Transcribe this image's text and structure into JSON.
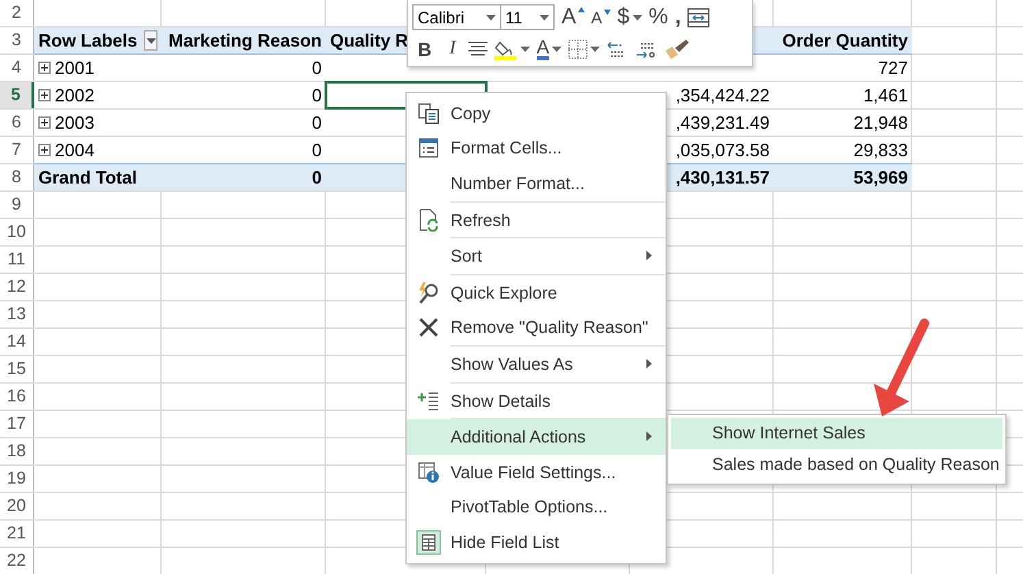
{
  "sheet": {
    "row_headers": [
      {
        "label": "2",
        "selected": false
      },
      {
        "label": "3",
        "selected": false
      },
      {
        "label": "4",
        "selected": false
      },
      {
        "label": "5",
        "selected": true
      },
      {
        "label": "6",
        "selected": false
      },
      {
        "label": "7",
        "selected": false
      },
      {
        "label": "8",
        "selected": false
      },
      {
        "label": "9",
        "selected": false
      },
      {
        "label": "10",
        "selected": false
      },
      {
        "label": "11",
        "selected": false
      },
      {
        "label": "12",
        "selected": false
      },
      {
        "label": "13",
        "selected": false
      },
      {
        "label": "14",
        "selected": false
      },
      {
        "label": "15",
        "selected": false
      },
      {
        "label": "16",
        "selected": false
      },
      {
        "label": "17",
        "selected": false
      },
      {
        "label": "18",
        "selected": false
      },
      {
        "label": "19",
        "selected": false
      },
      {
        "label": "20",
        "selected": false
      },
      {
        "label": "21",
        "selected": false
      },
      {
        "label": "22",
        "selected": false
      }
    ]
  },
  "pivot": {
    "header": {
      "row_labels": "Row Labels",
      "marketing_reason": "Marketing Reason",
      "quality_reason": "Quality R",
      "order_quantity": "Order Quantity"
    },
    "rows": [
      {
        "label": "2001",
        "marketing_reason": "0",
        "order_quantity": "727",
        "active": false
      },
      {
        "label": "2002",
        "marketing_reason": "0",
        "column_5": ",354,424.22",
        "order_quantity": "1,461",
        "active": true
      },
      {
        "label": "2003",
        "marketing_reason": "0",
        "column_5": ",439,231.49",
        "order_quantity": "21,948",
        "active": false
      },
      {
        "label": "2004",
        "marketing_reason": "0",
        "column_5": ",035,073.58",
        "order_quantity": "29,833",
        "active": false
      }
    ],
    "total": {
      "label": "Grand Total",
      "marketing_reason": "0",
      "column_5": ",430,131.57",
      "order_quantity": "53,969"
    }
  },
  "mini_toolbar": {
    "font": "Calibri",
    "size": "11",
    "grow": "A",
    "shrink": "A",
    "currency": "$",
    "percent": "%",
    "comma": ",",
    "bold": "B",
    "italic": "I",
    "font_color": "A"
  },
  "context_menu": {
    "items": [
      {
        "kind": "item",
        "label": "Copy",
        "submenu": false,
        "selected": false
      },
      {
        "kind": "item",
        "label": "Format Cells...",
        "submenu": false,
        "selected": false
      },
      {
        "kind": "item",
        "label": "Number Format...",
        "submenu": false,
        "selected": false
      },
      {
        "kind": "separator"
      },
      {
        "kind": "item",
        "label": "Refresh",
        "submenu": false,
        "selected": false
      },
      {
        "kind": "separator"
      },
      {
        "kind": "item",
        "label": "Sort",
        "submenu": true,
        "selected": false
      },
      {
        "kind": "separator"
      },
      {
        "kind": "item",
        "label": "Quick Explore",
        "submenu": false,
        "selected": false
      },
      {
        "kind": "item",
        "label": "Remove \"Quality Reason\"",
        "submenu": false,
        "selected": false
      },
      {
        "kind": "separator"
      },
      {
        "kind": "item",
        "label": "Show Values As",
        "submenu": true,
        "selected": false
      },
      {
        "kind": "separator"
      },
      {
        "kind": "item",
        "label": "Show Details",
        "submenu": false,
        "selected": false
      },
      {
        "kind": "separator"
      },
      {
        "kind": "item",
        "label": "Additional Actions",
        "submenu": true,
        "selected": true
      },
      {
        "kind": "item",
        "label": "Value Field Settings...",
        "submenu": false,
        "selected": false
      },
      {
        "kind": "item",
        "label": "PivotTable Options...",
        "submenu": false,
        "selected": false
      },
      {
        "kind": "item",
        "label": "Hide Field List",
        "submenu": false,
        "selected": false
      }
    ]
  },
  "submenu": {
    "items": [
      {
        "label": "Show Internet Sales",
        "selected": true
      },
      {
        "label": "Sales made based on Quality Reason",
        "selected": false
      }
    ]
  }
}
